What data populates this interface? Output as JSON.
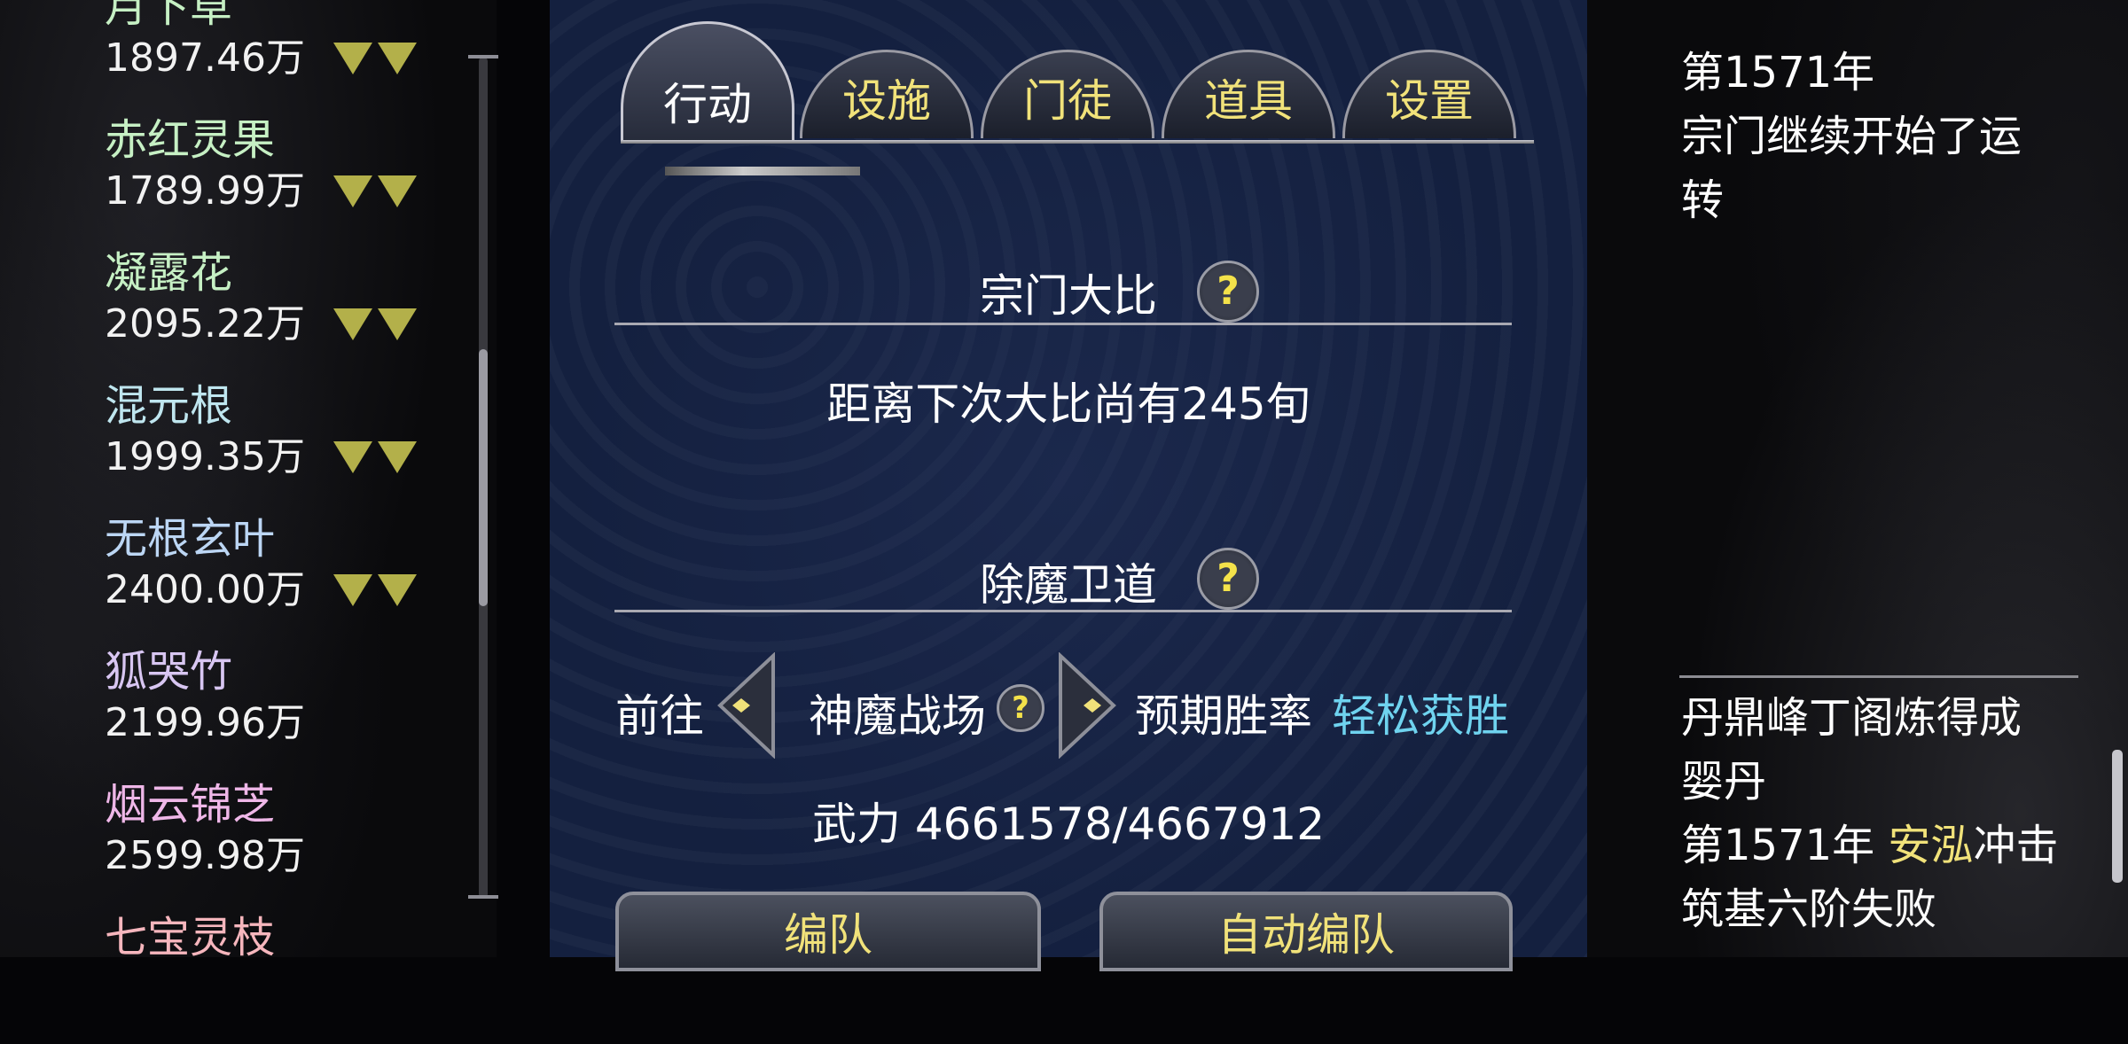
{
  "market": {
    "items": [
      {
        "name": "月下草",
        "price": "1897.46万",
        "name_color": "#c6f0c4",
        "trend": "down-down"
      },
      {
        "name": "赤红灵果",
        "price": "1789.99万",
        "name_color": "#c6f0c4",
        "trend": "down-down"
      },
      {
        "name": "凝露花",
        "price": "2095.22万",
        "name_color": "#c6f0c4",
        "trend": "down-down"
      },
      {
        "name": "混元根",
        "price": "1999.35万",
        "name_color": "#bfe6ef",
        "trend": "down-down"
      },
      {
        "name": "无根玄叶",
        "price": "2400.00万",
        "name_color": "#bcd6f4",
        "trend": "down-down"
      },
      {
        "name": "狐哭竹",
        "price": "2199.96万",
        "name_color": "#d8c6f2",
        "trend": ""
      },
      {
        "name": "烟云锦芝",
        "price": "2599.98万",
        "name_color": "#efb7e8",
        "trend": ""
      },
      {
        "name": "七宝灵枝",
        "price": "",
        "name_color": "#f6b6bd",
        "trend": ""
      }
    ],
    "trend_color": "#b3b04a"
  },
  "tabs": [
    {
      "label": "行动",
      "active": true
    },
    {
      "label": "设施",
      "active": false
    },
    {
      "label": "门徒",
      "active": false
    },
    {
      "label": "道具",
      "active": false
    },
    {
      "label": "设置",
      "active": false
    }
  ],
  "sect_contest": {
    "title": "宗门大比",
    "countdown_text": "距离下次大比尚有245旬"
  },
  "demon_hunt": {
    "title": "除魔卫道",
    "goto_label": "前往",
    "location": "神魔战场",
    "win_rate_label": "预期胜率",
    "win_rate_value": "轻松获胜",
    "win_rate_color": "#6fd3ef",
    "power_text": "武力 4661578/4667912"
  },
  "buttons": {
    "formation": "编队",
    "auto_formation": "自动编队"
  },
  "log": {
    "top_lines": [
      "第1571年",
      "宗门继续开始了运",
      "转"
    ],
    "bottom_lines": [
      "丹鼎峰丁阁炼得成",
      "婴丹"
    ],
    "event_year": "第1571年 ",
    "event_name": "安泓",
    "event_tail": "冲击",
    "event_line2": "筑基六阶失败"
  },
  "accent_color": "#f1e27a"
}
